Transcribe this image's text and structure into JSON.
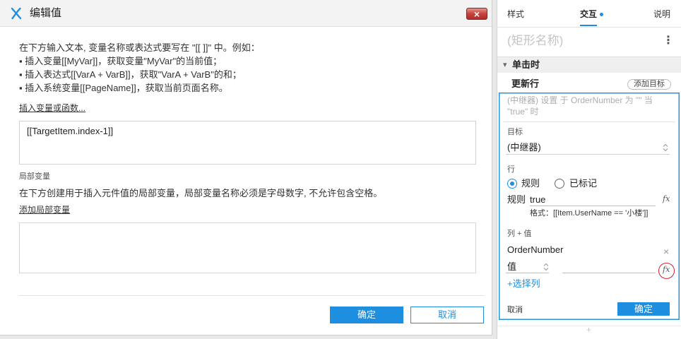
{
  "colors": {
    "accent": "#1e8fe0",
    "close_button_red": "#c8423d",
    "highlight_red": "#e02020",
    "placeholder_gray": "#c4c4c4"
  },
  "icons": {
    "logo": "axure-logo-icon",
    "close": "close-icon",
    "more": "more-vertical-icon",
    "collapse": "caret-down-icon",
    "stepper": "up-down-arrows-icon",
    "function": "function-icon",
    "remove": "remove-icon",
    "add": "plus-icon"
  },
  "dialog": {
    "title": "编辑值",
    "close_glyph": "×",
    "intro": "在下方输入文本, 变量名称或表达式要写在 \"[[ ]]\" 中。例如：",
    "bullets": [
      "▪ 插入变量[[MyVar]]，获取变量\"MyVar\"的当前值；",
      "▪ 插入表达式[[VarA + VarB]]，获取\"VarA + VarB\"的和；",
      "▪ 插入系统变量[[PageName]]，获取当前页面名称。"
    ],
    "insert_link": "插入变量或函数...",
    "expression": "[[TargetItem.index-1]]",
    "local_vars": {
      "heading": "局部变量",
      "description": "在下方创建用于插入元件值的局部变量，局部变量名称必须是字母数字, 不允许包含空格。",
      "add_link": "添加局部变量"
    },
    "ok_label": "确定",
    "cancel_label": "取消"
  },
  "panel": {
    "tabs": [
      {
        "label": "样式",
        "active": false,
        "has_indicator": false
      },
      {
        "label": "交互",
        "active": true,
        "has_indicator": true
      },
      {
        "label": "说明",
        "active": false,
        "has_indicator": false
      }
    ],
    "widget_name_placeholder": "(矩形名称)",
    "more_glyph": "⋮",
    "event": {
      "caret_glyph": "▾",
      "label": "单击时"
    },
    "action": {
      "label": "更新行",
      "add_target_label": "添加目标",
      "summary": "(中继器) 设置 于 OrderNumber 为 \"\" 当 \"true\" 时",
      "target": {
        "label": "目标",
        "value": "(中继器)"
      },
      "rows": {
        "label": "行",
        "options": [
          {
            "label": "规则",
            "selected": true
          },
          {
            "label": "已标记",
            "selected": false
          }
        ],
        "rule_label": "规则",
        "rule_value": "true",
        "function_glyph": "fx",
        "format_hint": "格式：[[Item.UserName == '小楼']]"
      },
      "columns": {
        "label": "列 + 值",
        "items": [
          {
            "name": "OrderNumber",
            "remove_glyph": "×",
            "value_type": "值",
            "value": ""
          }
        ],
        "add_column_label": "+选择列"
      },
      "cancel_label": "取消",
      "ok_label": "确定"
    },
    "add_glyph": "+"
  }
}
